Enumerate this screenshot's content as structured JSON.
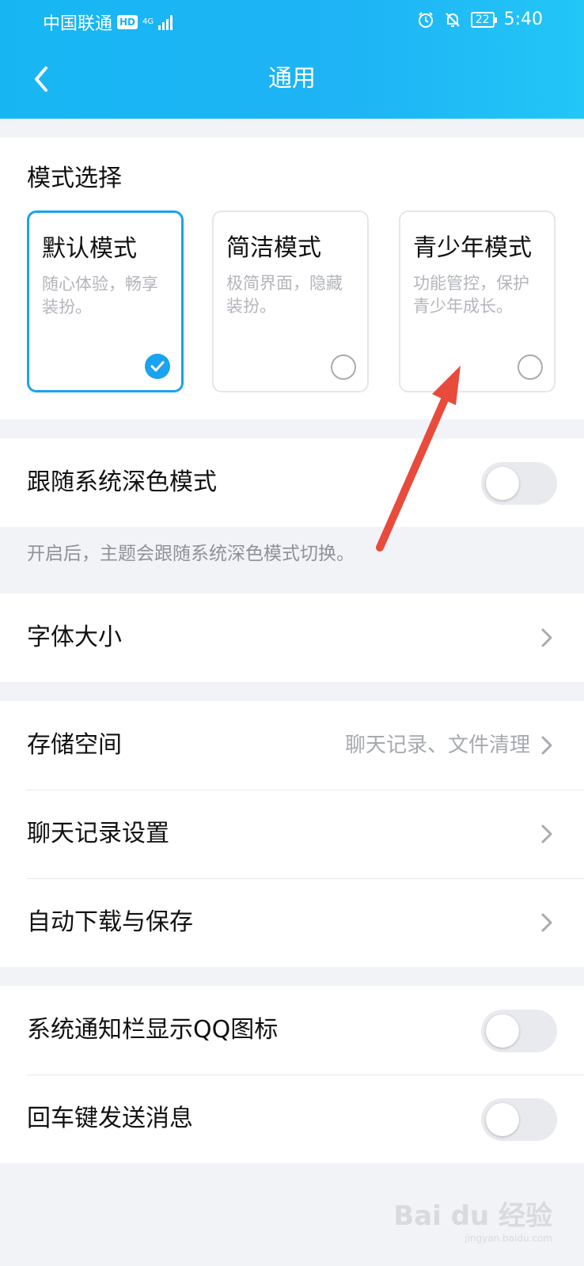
{
  "status_bar": {
    "carrier": "中国联通",
    "hd": "HD",
    "network": "4G",
    "battery": "22",
    "time": "5:40"
  },
  "header": {
    "title": "通用"
  },
  "mode_section": {
    "heading": "模式选择",
    "cards": [
      {
        "title": "默认模式",
        "desc": "随心体验，畅享装扮。",
        "selected": true
      },
      {
        "title": "简洁模式",
        "desc": "极简界面，隐藏装扮。",
        "selected": false
      },
      {
        "title": "青少年模式",
        "desc": "功能管控，保护青少年成长。",
        "selected": false
      }
    ]
  },
  "dark_mode": {
    "label": "跟随系统深色模式",
    "enabled": false,
    "note": "开启后，主题会跟随系统深色模式切换。"
  },
  "font_size": {
    "label": "字体大小"
  },
  "storage_group": {
    "storage_label": "存储空间",
    "storage_sub": "聊天记录、文件清理",
    "chat_history_label": "聊天记录设置",
    "auto_download_label": "自动下载与保存"
  },
  "toggles_group": {
    "notif_icon_label": "系统通知栏显示QQ图标",
    "notif_icon_enabled": false,
    "enter_send_label": "回车键发送消息",
    "enter_send_enabled": false
  },
  "watermark": {
    "main": "Bai du 经验",
    "sub": "jingyan.baidu.com"
  },
  "colors": {
    "header": "#1eb4f5",
    "accent": "#1aa3ee",
    "annotation_arrow": "#e84b3c"
  },
  "icons": [
    "alarm-icon",
    "mute-bell-icon",
    "back-chevron-icon",
    "check-icon",
    "chevron-right-icon",
    "signal-icon"
  ]
}
